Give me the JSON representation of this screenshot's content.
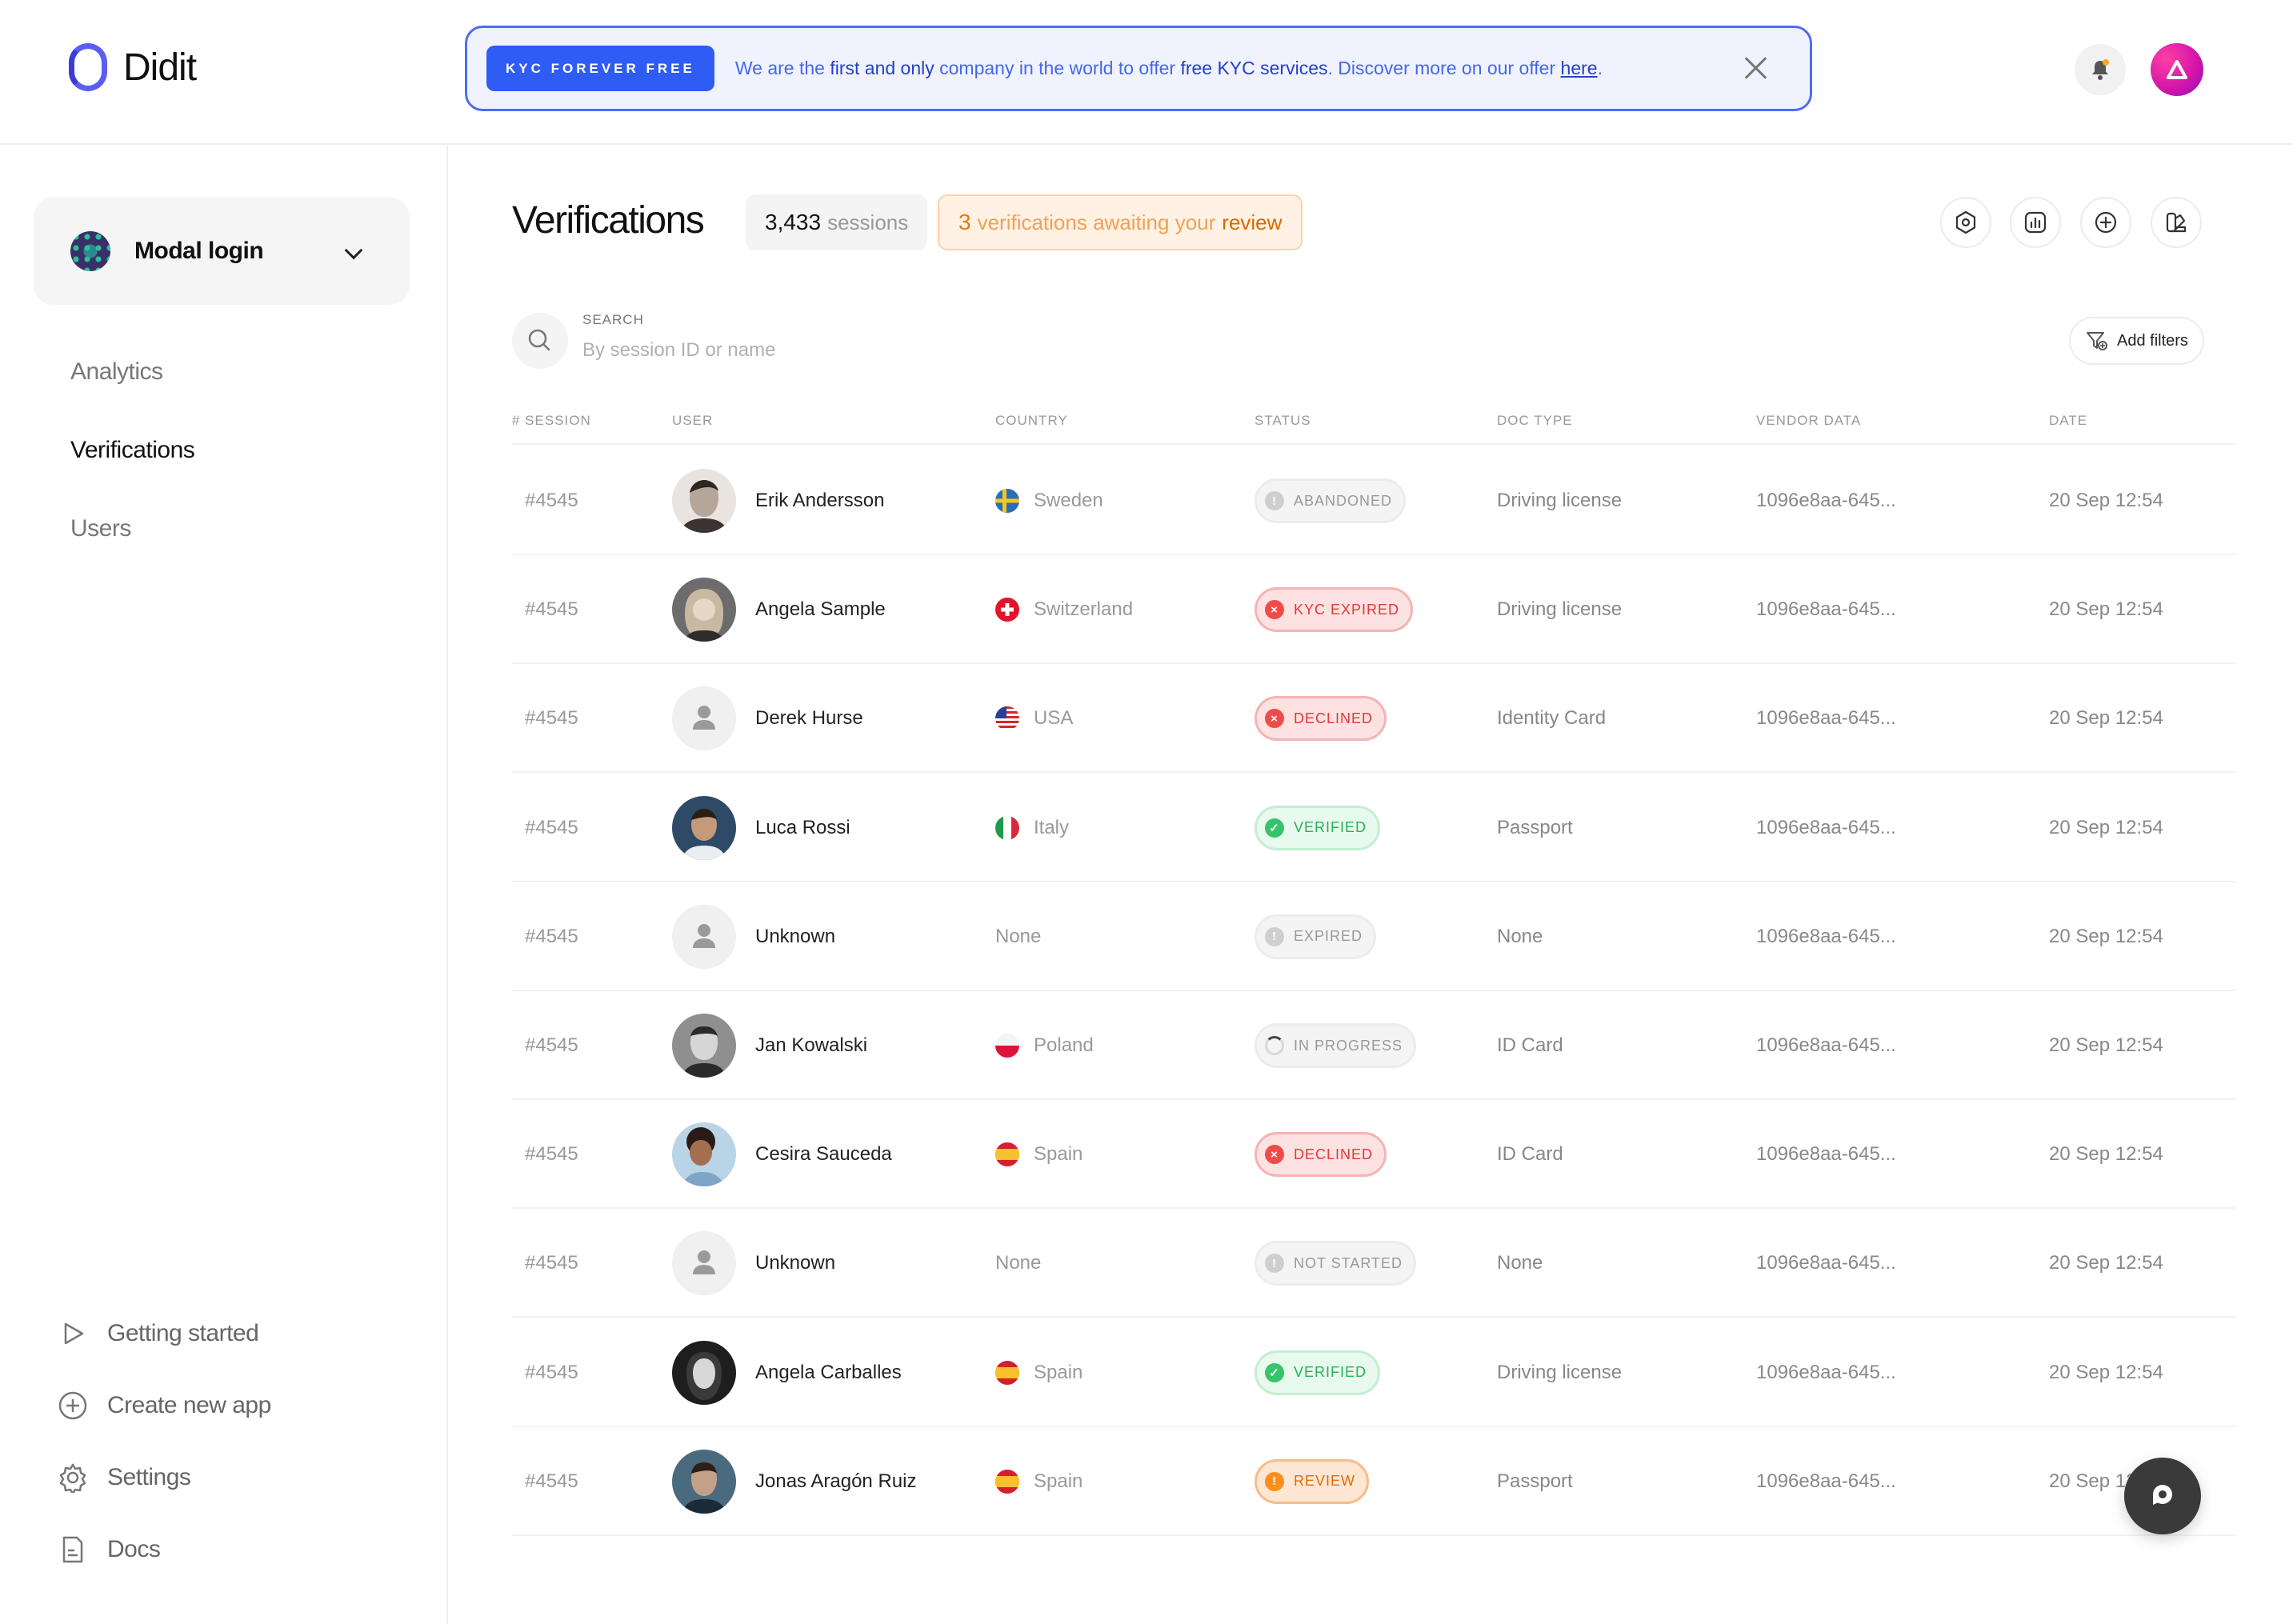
{
  "app": {
    "name": "Didit"
  },
  "banner": {
    "tag": "KYC FOREVER FREE",
    "text_1": "We are the ",
    "text_2": "first and only",
    "text_3": " company in the world to offer ",
    "text_4": "free KYC services",
    "text_5": ". Discover more on our offer ",
    "link": "here",
    "text_6": ".",
    "accent_color": "#2f5cf4"
  },
  "sidebar": {
    "app_select": "Modal login",
    "nav": [
      {
        "label": "Analytics",
        "active": false
      },
      {
        "label": "Verifications",
        "active": true
      },
      {
        "label": "Users",
        "active": false
      }
    ],
    "bottom": [
      {
        "label": "Getting started",
        "icon": "play-icon"
      },
      {
        "label": "Create new app",
        "icon": "plus-circle-icon"
      },
      {
        "label": "Settings",
        "icon": "gear-icon"
      },
      {
        "label": "Docs",
        "icon": "document-icon"
      }
    ]
  },
  "header": {
    "title": "Verifications",
    "sessions_count": "3,433",
    "sessions_label": "sessions",
    "review_count": "3",
    "review_text": "verifications awaiting your",
    "review_word": "review"
  },
  "search": {
    "label": "SEARCH",
    "placeholder": "By session ID or name",
    "value": ""
  },
  "filters": {
    "label": "Add filters"
  },
  "table": {
    "columns": [
      "# SESSION",
      "USER",
      "COUNTRY",
      "STATUS",
      "DOC TYPE",
      "VENDOR DATA",
      "DATE"
    ],
    "rows": [
      {
        "session": "#4545",
        "user": "Erik Andersson",
        "avatar": "photo-man-1",
        "country": "Sweden",
        "flag": "se",
        "status": "ABANDONED",
        "status_kind": "grey",
        "doc": "Driving license",
        "vendor": "1096e8aa-645...",
        "date": "20 Sep 12:54"
      },
      {
        "session": "#4545",
        "user": "Angela Sample",
        "avatar": "photo-woman-1",
        "country": "Switzerland",
        "flag": "ch",
        "status": "KYC EXPIRED",
        "status_kind": "red",
        "doc": "Driving license",
        "vendor": "1096e8aa-645...",
        "date": "20 Sep 12:54"
      },
      {
        "session": "#4545",
        "user": "Derek Hurse",
        "avatar": "placeholder",
        "country": "USA",
        "flag": "us",
        "status": "DECLINED",
        "status_kind": "red",
        "doc": "Identity Card",
        "vendor": "1096e8aa-645...",
        "date": "20 Sep 12:54"
      },
      {
        "session": "#4545",
        "user": "Luca Rossi",
        "avatar": "photo-man-2",
        "country": "Italy",
        "flag": "it",
        "status": "VERIFIED",
        "status_kind": "green",
        "doc": "Passport",
        "vendor": "1096e8aa-645...",
        "date": "20 Sep 12:54"
      },
      {
        "session": "#4545",
        "user": "Unknown",
        "avatar": "placeholder",
        "country": "None",
        "flag": "",
        "status": "EXPIRED",
        "status_kind": "grey",
        "doc": "None",
        "vendor": "1096e8aa-645...",
        "date": "20 Sep 12:54"
      },
      {
        "session": "#4545",
        "user": "Jan Kowalski",
        "avatar": "photo-man-3",
        "country": "Poland",
        "flag": "pl",
        "status": "IN PROGRESS",
        "status_kind": "progress",
        "doc": "ID Card",
        "vendor": "1096e8aa-645...",
        "date": "20 Sep 12:54"
      },
      {
        "session": "#4545",
        "user": "Cesira Sauceda",
        "avatar": "photo-woman-2",
        "country": "Spain",
        "flag": "es",
        "status": "DECLINED",
        "status_kind": "red",
        "doc": "ID Card",
        "vendor": "1096e8aa-645...",
        "date": "20 Sep 12:54"
      },
      {
        "session": "#4545",
        "user": "Unknown",
        "avatar": "placeholder",
        "country": "None",
        "flag": "",
        "status": "NOT STARTED",
        "status_kind": "grey",
        "doc": "None",
        "vendor": "1096e8aa-645...",
        "date": "20 Sep 12:54"
      },
      {
        "session": "#4545",
        "user": "Angela Carballes",
        "avatar": "photo-woman-3",
        "country": "Spain",
        "flag": "es",
        "status": "VERIFIED",
        "status_kind": "green",
        "doc": "Driving license",
        "vendor": "1096e8aa-645...",
        "date": "20 Sep 12:54"
      },
      {
        "session": "#4545",
        "user": "Jonas Aragón Ruiz",
        "avatar": "photo-man-4",
        "country": "Spain",
        "flag": "es",
        "status": "REVIEW",
        "status_kind": "orange",
        "doc": "Passport",
        "vendor": "1096e8aa-645...",
        "date": "20 Sep 12:54"
      }
    ]
  }
}
